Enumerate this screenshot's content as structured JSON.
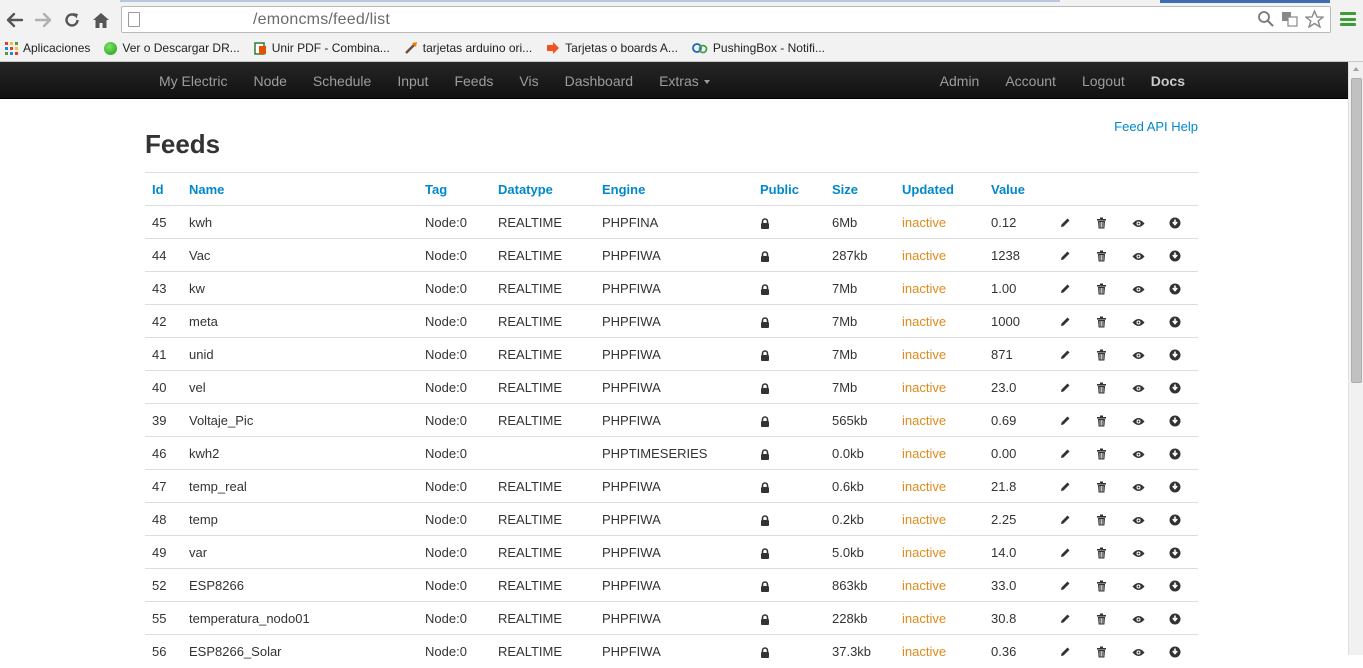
{
  "browser": {
    "url": "/emoncms/feed/list",
    "bookmarks": [
      {
        "label": "Aplicaciones",
        "icon": "apps-grid-icon"
      },
      {
        "label": "Ver o Descargar DR...",
        "icon": "green-circle-icon"
      },
      {
        "label": "Unir PDF - Combina...",
        "icon": "pdf-icon"
      },
      {
        "label": "tarjetas arduino ori...",
        "icon": "tool-icon"
      },
      {
        "label": "Tarjetas o boards A...",
        "icon": "arrow-icon"
      },
      {
        "label": "PushingBox - Notifi...",
        "icon": "pushingbox-icon"
      }
    ]
  },
  "navbar": {
    "left": [
      "My Electric",
      "Node",
      "Schedule",
      "Input",
      "Feeds",
      "Vis",
      "Dashboard",
      "Extras"
    ],
    "right": [
      "Admin",
      "Account",
      "Logout",
      "Docs"
    ]
  },
  "page": {
    "title": "Feeds",
    "help_link": "Feed API Help"
  },
  "table": {
    "columns": [
      "Id",
      "Name",
      "Tag",
      "Datatype",
      "Engine",
      "Public",
      "Size",
      "Updated",
      "Value"
    ],
    "rows": [
      {
        "id": "45",
        "name": "kwh",
        "tag": "Node:0",
        "datatype": "REALTIME",
        "engine": "PHPFINA",
        "size": "6Mb",
        "updated": "inactive",
        "value": "0.12"
      },
      {
        "id": "44",
        "name": "Vac",
        "tag": "Node:0",
        "datatype": "REALTIME",
        "engine": "PHPFIWA",
        "size": "287kb",
        "updated": "inactive",
        "value": "1238"
      },
      {
        "id": "43",
        "name": "kw",
        "tag": "Node:0",
        "datatype": "REALTIME",
        "engine": "PHPFIWA",
        "size": "7Mb",
        "updated": "inactive",
        "value": "1.00"
      },
      {
        "id": "42",
        "name": "meta",
        "tag": "Node:0",
        "datatype": "REALTIME",
        "engine": "PHPFIWA",
        "size": "7Mb",
        "updated": "inactive",
        "value": "1000"
      },
      {
        "id": "41",
        "name": "unid",
        "tag": "Node:0",
        "datatype": "REALTIME",
        "engine": "PHPFIWA",
        "size": "7Mb",
        "updated": "inactive",
        "value": "871"
      },
      {
        "id": "40",
        "name": "vel",
        "tag": "Node:0",
        "datatype": "REALTIME",
        "engine": "PHPFIWA",
        "size": "7Mb",
        "updated": "inactive",
        "value": "23.0"
      },
      {
        "id": "39",
        "name": "Voltaje_Pic",
        "tag": "Node:0",
        "datatype": "REALTIME",
        "engine": "PHPFIWA",
        "size": "565kb",
        "updated": "inactive",
        "value": "0.69"
      },
      {
        "id": "46",
        "name": "kwh2",
        "tag": "Node:0",
        "datatype": "",
        "engine": "PHPTIMESERIES",
        "size": "0.0kb",
        "updated": "inactive",
        "value": "0.00"
      },
      {
        "id": "47",
        "name": "temp_real",
        "tag": "Node:0",
        "datatype": "REALTIME",
        "engine": "PHPFIWA",
        "size": "0.6kb",
        "updated": "inactive",
        "value": "21.8"
      },
      {
        "id": "48",
        "name": "temp",
        "tag": "Node:0",
        "datatype": "REALTIME",
        "engine": "PHPFIWA",
        "size": "0.2kb",
        "updated": "inactive",
        "value": "2.25"
      },
      {
        "id": "49",
        "name": "var",
        "tag": "Node:0",
        "datatype": "REALTIME",
        "engine": "PHPFIWA",
        "size": "5.0kb",
        "updated": "inactive",
        "value": "14.0"
      },
      {
        "id": "52",
        "name": "ESP8266",
        "tag": "Node:0",
        "datatype": "REALTIME",
        "engine": "PHPFIWA",
        "size": "863kb",
        "updated": "inactive",
        "value": "33.0"
      },
      {
        "id": "55",
        "name": "temperatura_nodo01",
        "tag": "Node:0",
        "datatype": "REALTIME",
        "engine": "PHPFIWA",
        "size": "228kb",
        "updated": "inactive",
        "value": "30.8"
      },
      {
        "id": "56",
        "name": "ESP8266_Solar",
        "tag": "Node:0",
        "datatype": "REALTIME",
        "engine": "PHPFIWA",
        "size": "37.3kb",
        "updated": "inactive",
        "value": "0.36"
      }
    ]
  },
  "colors": {
    "accent": "#0088cc",
    "inactive": "#e08a1b",
    "navbar": "#1b1b1b"
  }
}
